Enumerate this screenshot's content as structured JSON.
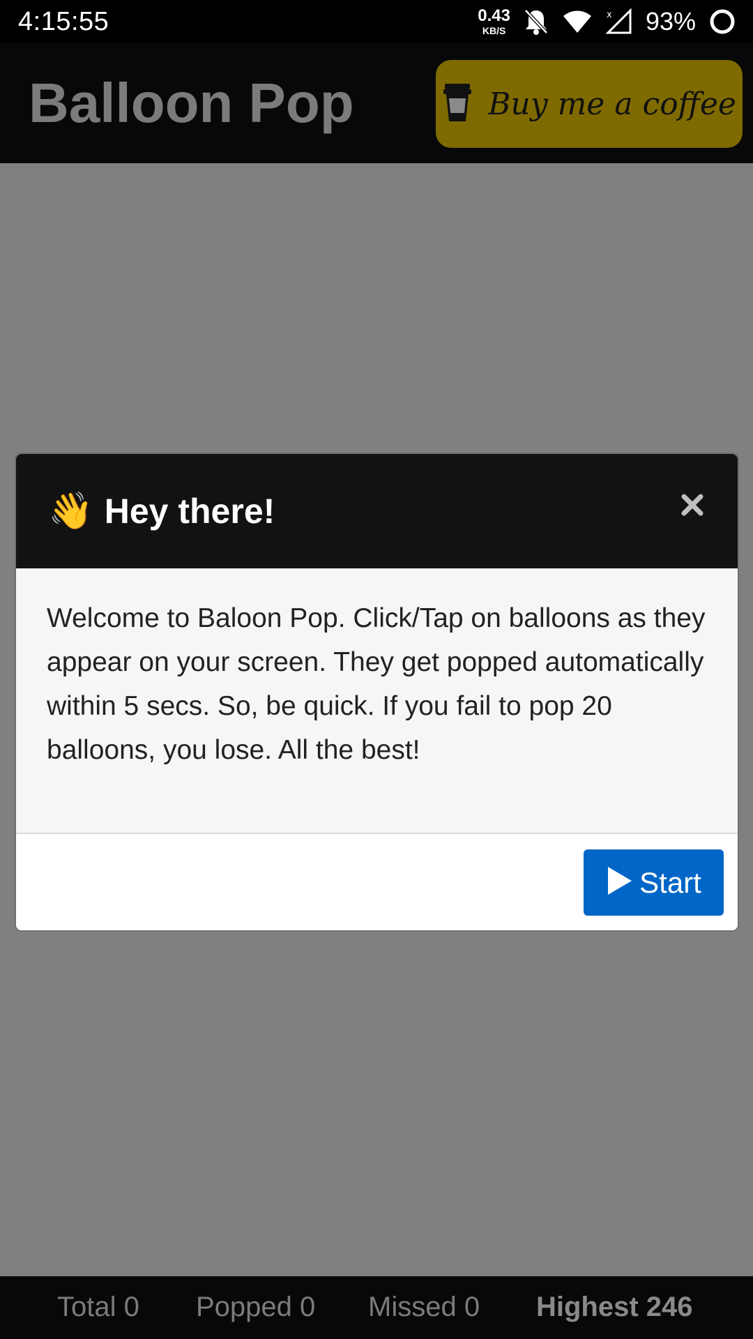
{
  "status_bar": {
    "time": "4:15:55",
    "net_speed_value": "0.43",
    "net_speed_unit": "KB/S",
    "battery": "93%",
    "icons": [
      "bell-off-icon",
      "wifi-icon",
      "cell-signal-icon",
      "battery-ring-icon"
    ]
  },
  "header": {
    "title": "Balloon Pop",
    "coffee_button_label": "Buy me a coffee",
    "coffee_icon": "coffee-cup-icon",
    "accent_color": "#7f6a00"
  },
  "modal": {
    "emoji": "👋",
    "title": "Hey there!",
    "close_icon": "close-icon",
    "body": "Welcome to Baloon Pop. Click/Tap on balloons as they appear on your screen. They get popped automatically within 5 secs. So, be quick. If you fail to pop 20 balloons, you lose. All the best!",
    "start_label": "Start",
    "start_icon": "play-icon",
    "start_color": "#0066c8"
  },
  "stats": {
    "total": "Total 0",
    "popped": "Popped 0",
    "missed": "Missed 0",
    "highest": "Highest 246"
  }
}
